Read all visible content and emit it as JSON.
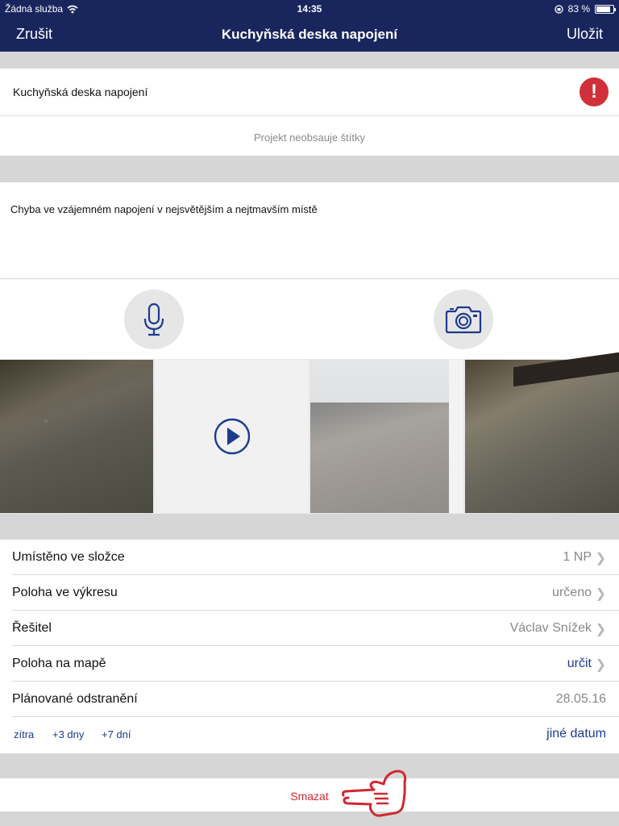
{
  "status": {
    "carrier": "Žádná služba",
    "time": "14:35",
    "battery": "83 %",
    "battery_level": 0.83
  },
  "nav": {
    "cancel": "Zrušit",
    "title": "Kuchyňská deska napojení",
    "save": "Uložit"
  },
  "defect": {
    "name": "Kuchyňská deska napojení",
    "alert": "!",
    "tags_placeholder": "Projekt neobsauje štítky"
  },
  "description": "Chyba ve vzájemném napojení v nejsvětějším a nejtmavším místě",
  "icons": {
    "mic": "microphone-icon",
    "camera": "camera-icon",
    "play": "play-icon"
  },
  "rows": [
    {
      "label": "Umístěno ve složce",
      "value": "1 NP"
    },
    {
      "label": "Poloha ve výkresu",
      "value": "určeno"
    },
    {
      "label": "Řešitel",
      "value": "Václav Snížek"
    },
    {
      "label": "Poloha na mapě",
      "value": "určit"
    },
    {
      "label": "Plánované odstranění",
      "value": "28.05.16"
    }
  ],
  "quick_dates": {
    "tomorrow": "zítra",
    "plus3": "+3 dny",
    "plus7": "+7 dní",
    "other": "jiné datum"
  },
  "delete_label": "Smazat",
  "colors": {
    "navbar": "#19265e",
    "accent": "#1c3b8d",
    "danger": "#d0282f",
    "alert": "#d0303a"
  }
}
